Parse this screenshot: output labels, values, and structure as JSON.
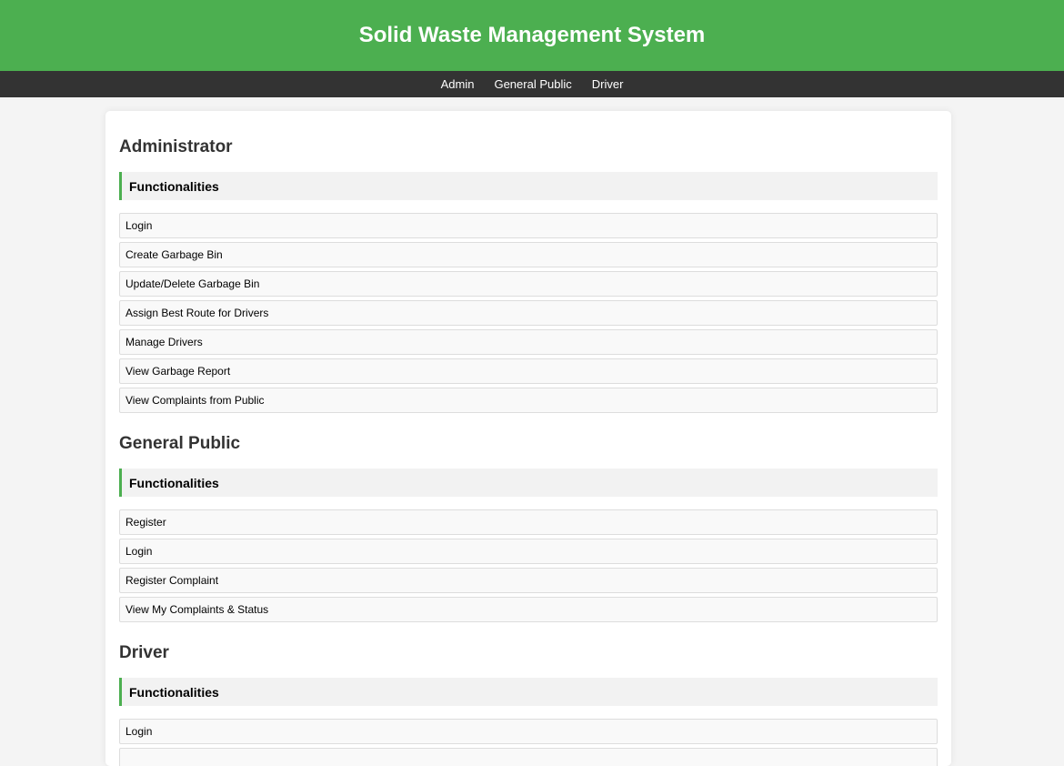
{
  "header": {
    "title": "Solid Waste Management System"
  },
  "nav": {
    "items": [
      {
        "label": "Admin"
      },
      {
        "label": "General Public"
      },
      {
        "label": "Driver"
      }
    ]
  },
  "sections": [
    {
      "title": "Administrator",
      "func_header": "Functionalities",
      "items": [
        "Login",
        "Create Garbage Bin",
        "Update/Delete Garbage Bin",
        "Assign Best Route for Drivers",
        "Manage Drivers",
        "View Garbage Report",
        "View Complaints from Public"
      ]
    },
    {
      "title": "General Public",
      "func_header": "Functionalities",
      "items": [
        "Register",
        "Login",
        "Register Complaint",
        "View My Complaints & Status"
      ]
    },
    {
      "title": "Driver",
      "func_header": "Functionalities",
      "items": [
        "Login",
        ""
      ]
    }
  ],
  "colors": {
    "header_bg": "#4caf50",
    "nav_bg": "#333333",
    "accent": "#4caf50",
    "page_bg": "#f4f4f4"
  }
}
